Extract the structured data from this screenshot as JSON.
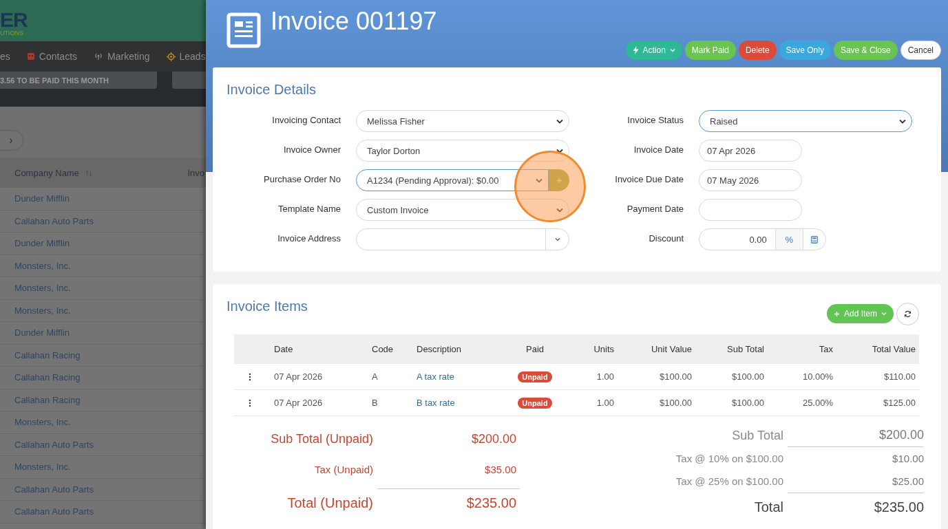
{
  "background_page": {
    "logo_text": "ER",
    "logo_subtext": "UTIONS",
    "nav": [
      "es",
      "Contacts",
      "Marketing",
      "Leads"
    ],
    "banner": "3.56 TO BE PAID THIS MONTH",
    "pager_next": "›",
    "columns": [
      "Company Name",
      "Invo"
    ],
    "rows": [
      "Dunder Mifflin",
      "Callahan Auto Parts",
      "Dunder Mifflin",
      "Monsters, Inc.",
      "Monsters, Inc.",
      "Monsters, Inc.",
      "Dunder Mifflin",
      "Callahan Racing",
      "Callahan Racing",
      "Callahan Racing",
      "Monsters, Inc.",
      "Callahan Auto Parts",
      "Monsters, Inc.",
      "Callahan Auto Parts",
      "Callahan Auto Parts"
    ]
  },
  "modal": {
    "title": "Invoice 001197",
    "actions": [
      {
        "label": "Action",
        "kind": "action"
      },
      {
        "label": "Mark Paid",
        "kind": "success"
      },
      {
        "label": "Delete",
        "kind": "danger"
      },
      {
        "label": "Save Only",
        "kind": "info"
      },
      {
        "label": "Save & Close",
        "kind": "success"
      },
      {
        "label": "Cancel",
        "kind": "plain"
      }
    ],
    "details": {
      "heading": "Invoice Details",
      "left_fields": [
        {
          "label": "Invoicing Contact",
          "value": "Melissa Fisher",
          "kind": "select",
          "focused": false
        },
        {
          "label": "Invoice Owner",
          "value": "Taylor Dorton",
          "kind": "select",
          "focused": false
        },
        {
          "label": "Purchase Order No",
          "value": "A1234 (Pending Approval): $0.00",
          "kind": "select-add",
          "focused": true
        },
        {
          "label": "Template Name",
          "value": "Custom Invoice",
          "kind": "select",
          "focused": false
        },
        {
          "label": "Invoice Address",
          "kind": "combo",
          "focused": false
        }
      ],
      "right_fields": [
        {
          "label": "Invoice Status",
          "value": "Raised",
          "kind": "select",
          "focused": true
        },
        {
          "label": "Invoice Date",
          "value": "07 Apr 2026",
          "kind": "date",
          "focused": false
        },
        {
          "label": "Invoice Due Date",
          "value": "07 May 2026",
          "kind": "date",
          "focused": false
        },
        {
          "label": "Payment Date",
          "kind": "date",
          "focused": false
        },
        {
          "label": "Discount",
          "value": "0.00",
          "addon": "%",
          "kind": "discount",
          "focused": false
        }
      ]
    },
    "items": {
      "heading": "Invoice Items",
      "add_button": "Add Item",
      "columns": [
        "Date",
        "Code",
        "Description",
        "Paid",
        "Units",
        "Unit Value",
        "Sub Total",
        "Tax",
        "Total Value"
      ],
      "rows": [
        {
          "date": "07 Apr 2026",
          "code": "A",
          "description": "A tax rate",
          "paid_label": "Unpaid",
          "paid": false,
          "units": "1.00",
          "unit_value": "$100.00",
          "sub_total": "$100.00",
          "tax": "10.00%",
          "total": "$110.00"
        },
        {
          "date": "07 Apr 2026",
          "code": "B",
          "description": "B tax rate",
          "paid_label": "Unpaid",
          "paid": false,
          "units": "1.00",
          "unit_value": "$100.00",
          "sub_total": "$100.00",
          "tax": "25.00%",
          "total": "$125.00"
        }
      ],
      "unpaid_summary": [
        {
          "label": "Sub Total (Unpaid)",
          "value": "$200.00",
          "kind": "subtotal"
        },
        {
          "label": "Tax (Unpaid)",
          "value": "$35.00",
          "kind": "tax"
        },
        {
          "label": "Total (Unpaid)",
          "value": "$235.00",
          "kind": "total"
        }
      ],
      "totals": [
        {
          "label": "Sub Total",
          "value": "$200.00",
          "kind": "subtotal"
        },
        {
          "label": "Tax @ 10% on $100.00",
          "value": "$10.00",
          "kind": "tax"
        },
        {
          "label": "Tax @ 25% on $100.00",
          "value": "$25.00",
          "kind": "tax"
        },
        {
          "label": "Total",
          "value": "$235.00",
          "kind": "total"
        }
      ]
    }
  }
}
